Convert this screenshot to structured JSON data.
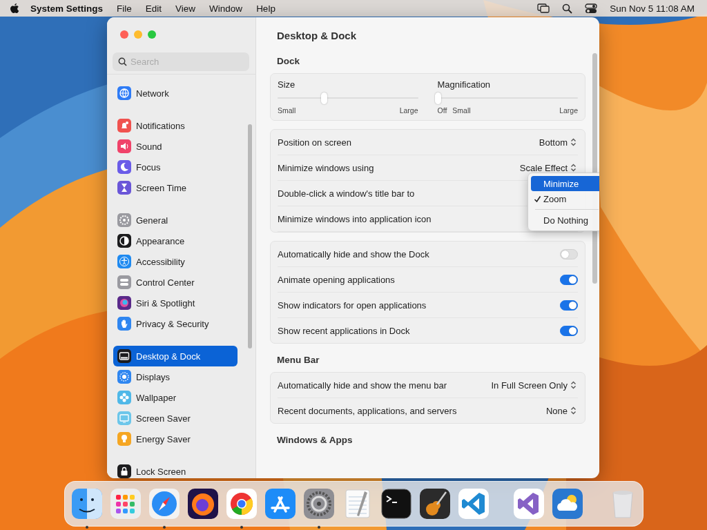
{
  "menu_bar": {
    "app_name": "System Settings",
    "menus": [
      "File",
      "Edit",
      "View",
      "Window",
      "Help"
    ],
    "clock": "Sun Nov 5  11:08 AM"
  },
  "window": {
    "title": "Desktop & Dock",
    "sidebar": {
      "search": {
        "placeholder": "Search"
      },
      "groups": [
        [
          {
            "label": "Network",
            "kind": "network",
            "color": "#2f7cf6",
            "selected": false
          }
        ],
        [
          {
            "label": "Notifications",
            "kind": "notifications",
            "color": "#f0524f",
            "selected": false
          },
          {
            "label": "Sound",
            "kind": "sound",
            "color": "#f0436a",
            "selected": false
          },
          {
            "label": "Focus",
            "kind": "focus",
            "color": "#6a5ce8",
            "selected": false
          },
          {
            "label": "Screen Time",
            "kind": "screentime",
            "color": "#6a56d8",
            "selected": false
          }
        ],
        [
          {
            "label": "General",
            "kind": "general",
            "color": "#9a9aa0",
            "selected": false
          },
          {
            "label": "Appearance",
            "kind": "appearance",
            "color": "#1c1c1e",
            "selected": false
          },
          {
            "label": "Accessibility",
            "kind": "accessibility",
            "color": "#1f8af0",
            "selected": false
          },
          {
            "label": "Control Center",
            "kind": "controlcenter",
            "color": "#9a9aa0",
            "selected": false
          },
          {
            "label": "Siri & Spotlight",
            "kind": "siri",
            "color": "#5a2a8a",
            "selected": false
          },
          {
            "label": "Privacy & Security",
            "kind": "privacy",
            "color": "#2f86f0",
            "selected": false
          }
        ],
        [
          {
            "label": "Desktop & Dock",
            "kind": "dock",
            "color": "#1c1c1e",
            "selected": true
          },
          {
            "label": "Displays",
            "kind": "displays",
            "color": "#2f86f0",
            "selected": false
          },
          {
            "label": "Wallpaper",
            "kind": "wallpaper",
            "color": "#4fb8e8",
            "selected": false
          },
          {
            "label": "Screen Saver",
            "kind": "screensaver",
            "color": "#6cc6ea",
            "selected": false
          },
          {
            "label": "Energy Saver",
            "kind": "energy",
            "color": "#f5a623",
            "selected": false
          }
        ],
        [
          {
            "label": "Lock Screen",
            "kind": "lock",
            "color": "#1c1c1e",
            "selected": false
          }
        ]
      ]
    },
    "sections": [
      {
        "title": "Dock",
        "sliders": [
          {
            "label": "Size",
            "level": 0.33,
            "ticks": [
              "Small",
              "Large"
            ]
          },
          {
            "label": "Magnification",
            "level": 0.0,
            "ticks": [
              "Off",
              "Small",
              "Large"
            ]
          }
        ],
        "cards": [
          [
            {
              "label": "Position on screen",
              "kind": "select",
              "value": "Bottom"
            },
            {
              "label": "Minimize windows using",
              "kind": "select",
              "value": "Scale Effect"
            },
            {
              "label": "Double-click a window's title bar to",
              "kind": "plain"
            },
            {
              "label": "Minimize windows into application icon",
              "kind": "plain"
            }
          ],
          [
            {
              "label": "Automatically hide and show the Dock",
              "kind": "toggle",
              "on": false
            },
            {
              "label": "Animate opening applications",
              "kind": "toggle",
              "on": true
            },
            {
              "label": "Show indicators for open applications",
              "kind": "toggle",
              "on": true
            },
            {
              "label": "Show recent applications in Dock",
              "kind": "toggle",
              "on": true
            }
          ]
        ]
      },
      {
        "title": "Menu Bar",
        "cards": [
          [
            {
              "label": "Automatically hide and show the menu bar",
              "kind": "select",
              "value": "In Full Screen Only"
            },
            {
              "label": "Recent documents, applications, and servers",
              "kind": "select",
              "value": "None"
            }
          ]
        ]
      },
      {
        "title": "Windows & Apps"
      }
    ],
    "popup_menu": {
      "items": [
        {
          "label": "Minimize",
          "selected": true,
          "checked": false
        },
        {
          "label": "Zoom",
          "selected": false,
          "checked": true
        },
        {
          "label": "Do Nothing",
          "selected": false,
          "checked": false,
          "separator_before": true
        }
      ]
    }
  },
  "dock": [
    {
      "kind": "finder",
      "running": true
    },
    {
      "kind": "launchpad"
    },
    {
      "kind": "safari",
      "running": true
    },
    {
      "kind": "firefox"
    },
    {
      "kind": "chrome",
      "running": true
    },
    {
      "kind": "appstore"
    },
    {
      "kind": "settings",
      "running": true
    },
    {
      "kind": "textedit"
    },
    {
      "kind": "terminal"
    },
    {
      "kind": "garageband"
    },
    {
      "kind": "vscode"
    },
    {
      "kind": "separator"
    },
    {
      "kind": "vstudio"
    },
    {
      "kind": "weather"
    },
    {
      "kind": "separator"
    },
    {
      "kind": "trash"
    }
  ]
}
